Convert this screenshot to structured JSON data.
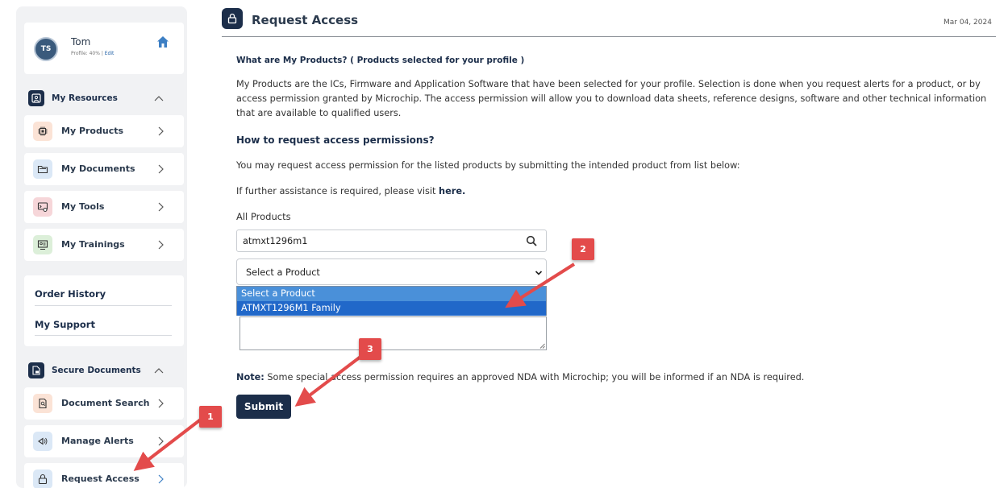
{
  "sidebar": {
    "profile": {
      "initials": "TS",
      "name": "Tom",
      "profile_text": "Profile: 40% | ",
      "edit_label": "Edit"
    },
    "resources_label": "My Resources",
    "resources_items": [
      {
        "label": "My Products",
        "icon": "chip-icon",
        "color": "#fbe3d6"
      },
      {
        "label": "My Documents",
        "icon": "folder-icon",
        "color": "#dbe8f6"
      },
      {
        "label": "My Tools",
        "icon": "tools-icon",
        "color": "#f6d6d9"
      },
      {
        "label": "My Trainings",
        "icon": "training-icon",
        "color": "#dcefd9"
      }
    ],
    "links": [
      "Order History",
      "My Support"
    ],
    "secure_label": "Secure Documents",
    "secure_items": [
      {
        "label": "Document Search",
        "icon": "document-search-icon",
        "color": "#fbe3d6"
      },
      {
        "label": "Manage Alerts",
        "icon": "alerts-icon",
        "color": "#dbe8f6"
      },
      {
        "label": "Request Access",
        "icon": "lock-icon",
        "color": "#dbe8f6"
      }
    ]
  },
  "header": {
    "title": "Request Access",
    "date": "Mar 04, 2024"
  },
  "content": {
    "q1": "What are My Products? ( Products selected for your profile )",
    "para": "My Products are the ICs, Firmware and Application Software that have been selected for your profile. Selection is done when you request alerts for a product, or by access permission granted by Microchip. The access permission will allow you to download data sheets, reference designs, software and other technical information that are available to qualified users.",
    "q2": "How to request access permissions?",
    "p2": "You may request access permission for the listed products by submitting the intended product from list below:",
    "p3_prefix": "If further assistance is required, please visit ",
    "p3_link": "here.",
    "all_products_label": "All Products",
    "search_value": "atmxt1296m1",
    "select_value": "Select a Product",
    "options": [
      "Select a Product",
      "ATMXT1296M1 Family"
    ],
    "note_label": "Note:",
    "note_text": " Some special access permission requires an approved NDA with Microchip; you will be informed if an NDA is required.",
    "submit_label": "Submit"
  },
  "annotations": [
    "1",
    "2",
    "3"
  ],
  "colors": {
    "navy": "#1c2e4a",
    "highlight": "#2168c9",
    "annotation_red": "#e34b4b"
  }
}
